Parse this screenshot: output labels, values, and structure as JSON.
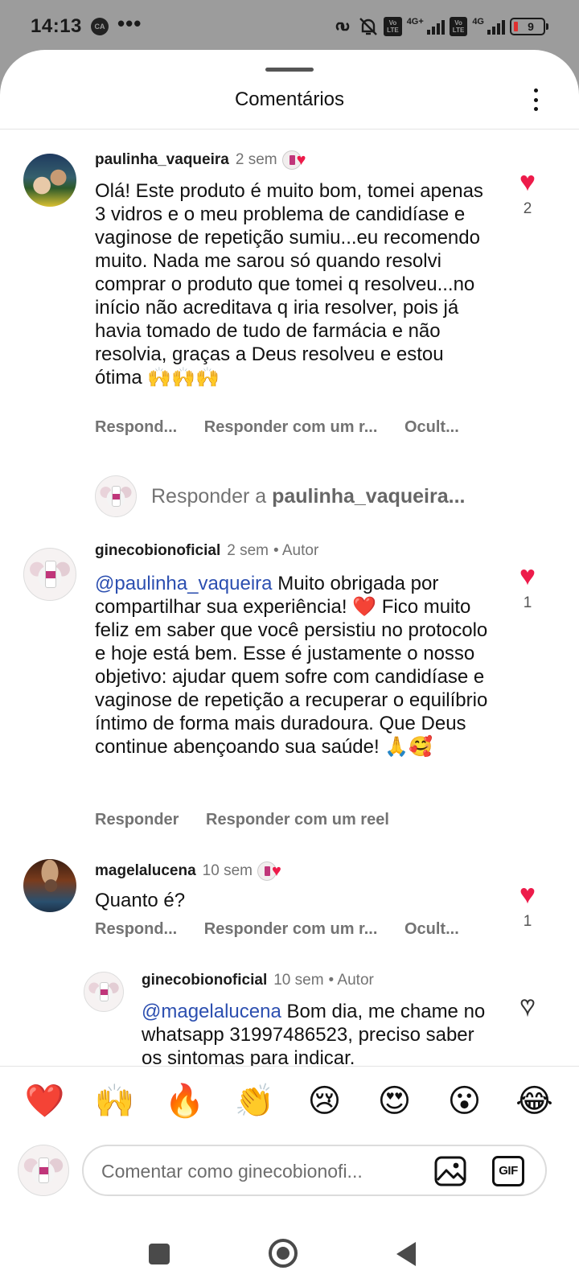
{
  "status_bar": {
    "time": "14:13",
    "carrier_badge": "CA",
    "more": "•••",
    "net1": "4G+",
    "net2": "4G",
    "volte": "Vo LTE",
    "battery": "9",
    "icons": [
      "link-icon",
      "bell-off-icon",
      "volte-icon",
      "signal-icon",
      "battery-icon"
    ]
  },
  "header": {
    "title": "Comentários"
  },
  "comments": [
    {
      "user": "paulinha_vaqueira",
      "time": "2 sem",
      "text": "Olá! Este produto é muito bom, tomei apenas 3 vidros e o meu problema de candidíase e vaginose de repetição sumiu...eu recomendo muito. Nada me sarou só quando resolvi comprar o produto que tomei q resolveu...no início não acreditava q iria resolver, pois já havia tomado de tudo de farmácia e não resolvia, graças a Deus resolveu e estou ótima 🙌🙌🙌",
      "likes": "2",
      "actions": [
        "Respond...",
        "Responder com um r...",
        "Ocult..."
      ]
    },
    {
      "user": "ginecobionoficial",
      "time": "2 sem",
      "author": "• Autor",
      "mention": "@paulinha_vaqueira",
      "text": " Muito obrigada por compartilhar sua experiência! ❤️ Fico muito feliz em saber que você persistiu no protocolo e hoje está bem. Esse é justamente o nosso objetivo: ajudar quem sofre com candidíase e vaginose de repetição a recuperar o equilíbrio íntimo de forma mais duradoura. Que Deus continue abençoando sua saúde! 🙏🥰",
      "likes": "1",
      "actions": [
        "Responder",
        "Responder com um reel"
      ]
    },
    {
      "user": "magelalucena",
      "time": "10 sem",
      "text": "Quanto é?",
      "likes": "1",
      "actions": [
        "Respond...",
        "Responder com um r...",
        "Ocult..."
      ]
    },
    {
      "user": "ginecobionoficial",
      "time": "10 sem",
      "author": "• Autor",
      "mention": "@magelalucena",
      "text": " Bom dia, me chame no whatsapp 31997486523, preciso saber os sintomas para indicar."
    }
  ],
  "reply_prompt": {
    "prefix": "Responder a ",
    "user": "paulinha_vaqueira..."
  },
  "emoji_bar": [
    "❤️",
    "🙌",
    "🔥",
    "👏",
    "😢",
    "😍",
    "😮",
    "😂"
  ],
  "input": {
    "placeholder": "Comentar como ginecobionofi...",
    "gif_label": "GIF"
  },
  "colors": {
    "like": "#ed1b4a",
    "mention": "#2c4fb0",
    "muted": "#737373"
  }
}
